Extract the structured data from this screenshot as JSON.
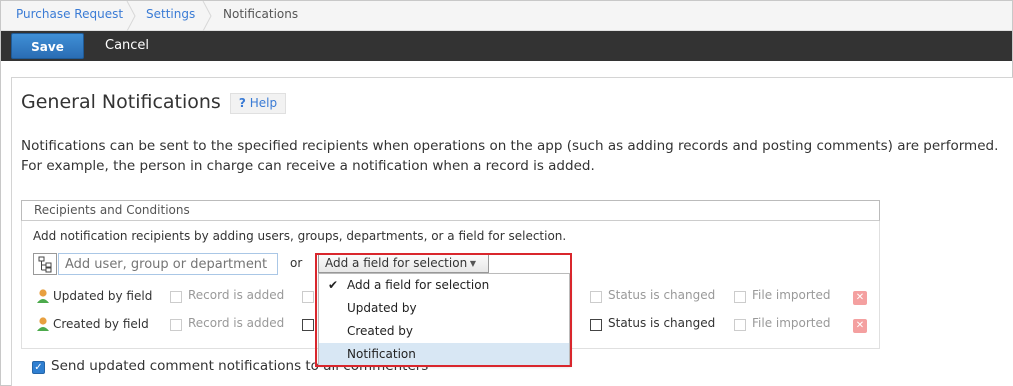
{
  "breadcrumb": {
    "items": [
      {
        "label": "Purchase Request"
      },
      {
        "label": "Settings"
      },
      {
        "label": "Notifications"
      }
    ]
  },
  "toolbar": {
    "save_label": "Save",
    "cancel_label": "Cancel"
  },
  "page": {
    "title": "General Notifications",
    "help_label": "Help",
    "description_line1": "Notifications can be sent to the specified recipients when operations on the app (such as adding records and posting comments) are performed.",
    "description_line2": "For example, the person in charge can receive a notification when a record is added."
  },
  "recipients": {
    "header": "Recipients and Conditions",
    "instruction": "Add notification recipients by adding users, groups, departments, or a field for selection.",
    "input_placeholder": "Add user, group or department",
    "or_label": "or",
    "field_select_label": "Add a field for selection",
    "rows": [
      {
        "label": "Updated by field",
        "record_added": "Record is added",
        "status_changed": "Status is changed",
        "file_imported": "File imported"
      },
      {
        "label": "Created by field",
        "record_added": "Record is added",
        "status_changed": "Status is changed",
        "file_imported": "File imported"
      }
    ]
  },
  "send_comment": {
    "label": "Send updated comment notifications to all commenters",
    "checked": true
  },
  "dropdown": {
    "items": [
      {
        "label": "Add a field for selection",
        "checked": true
      },
      {
        "label": "Updated by"
      },
      {
        "label": "Created by"
      },
      {
        "label": "Notification",
        "highlighted": true
      }
    ]
  },
  "colors": {
    "accent": "#3a7bd5",
    "toolbar": "#333333",
    "highlight_border": "#d9262c",
    "selected_item": "#d8e7f4"
  },
  "icons": [
    "chevron-right-icon",
    "org-tree-icon",
    "person-icon",
    "dropdown-caret-icon",
    "checkmark-icon",
    "close-icon"
  ]
}
